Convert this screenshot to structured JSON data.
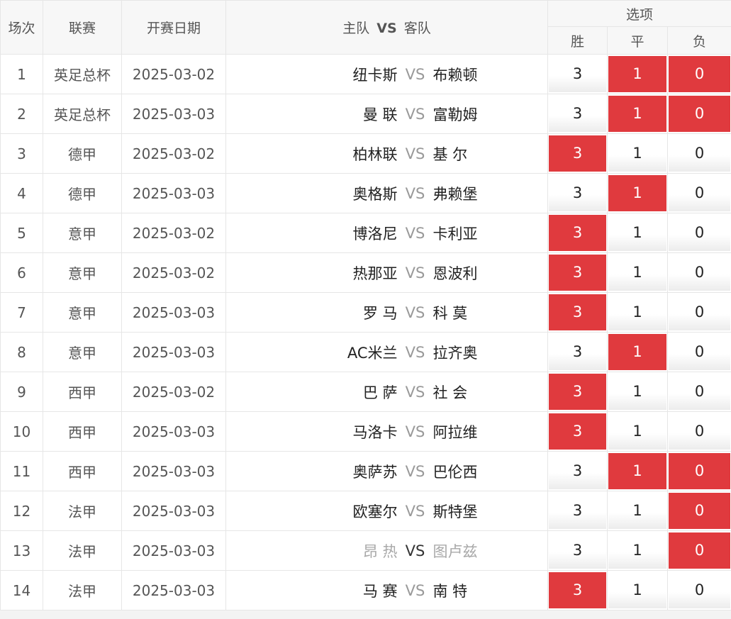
{
  "header": {
    "idx": "场次",
    "league": "联赛",
    "date": "开赛日期",
    "home": "主队",
    "vs": "VS",
    "away": "客队",
    "options": "选项",
    "win": "胜",
    "draw": "平",
    "lose": "负"
  },
  "colors": {
    "selected": "#e03a3e",
    "header_bg": "#f7f7f7"
  },
  "rows": [
    {
      "idx": "1",
      "league": "英足总杯",
      "date": "2025-03-02",
      "home": "纽卡斯",
      "vs": "VS",
      "away": "布赖顿",
      "win": "3",
      "draw": "1",
      "lose": "0",
      "sel": [
        "draw",
        "lose"
      ]
    },
    {
      "idx": "2",
      "league": "英足总杯",
      "date": "2025-03-03",
      "home": "曼 联",
      "vs": "VS",
      "away": "富勒姆",
      "win": "3",
      "draw": "1",
      "lose": "0",
      "sel": [
        "draw",
        "lose"
      ]
    },
    {
      "idx": "3",
      "league": "德甲",
      "date": "2025-03-02",
      "home": "柏林联",
      "vs": "VS",
      "away": "基 尔",
      "win": "3",
      "draw": "1",
      "lose": "0",
      "sel": [
        "win"
      ]
    },
    {
      "idx": "4",
      "league": "德甲",
      "date": "2025-03-03",
      "home": "奥格斯",
      "vs": "VS",
      "away": "弗赖堡",
      "win": "3",
      "draw": "1",
      "lose": "0",
      "sel": [
        "draw"
      ]
    },
    {
      "idx": "5",
      "league": "意甲",
      "date": "2025-03-02",
      "home": "博洛尼",
      "vs": "VS",
      "away": "卡利亚",
      "win": "3",
      "draw": "1",
      "lose": "0",
      "sel": [
        "win"
      ]
    },
    {
      "idx": "6",
      "league": "意甲",
      "date": "2025-03-02",
      "home": "热那亚",
      "vs": "VS",
      "away": "恩波利",
      "win": "3",
      "draw": "1",
      "lose": "0",
      "sel": [
        "win"
      ]
    },
    {
      "idx": "7",
      "league": "意甲",
      "date": "2025-03-03",
      "home": "罗 马",
      "vs": "VS",
      "away": "科 莫",
      "win": "3",
      "draw": "1",
      "lose": "0",
      "sel": [
        "win"
      ]
    },
    {
      "idx": "8",
      "league": "意甲",
      "date": "2025-03-03",
      "home": "AC米兰",
      "vs": "VS",
      "away": "拉齐奥",
      "win": "3",
      "draw": "1",
      "lose": "0",
      "sel": [
        "draw"
      ]
    },
    {
      "idx": "9",
      "league": "西甲",
      "date": "2025-03-02",
      "home": "巴 萨",
      "vs": "VS",
      "away": "社 会",
      "win": "3",
      "draw": "1",
      "lose": "0",
      "sel": [
        "win"
      ]
    },
    {
      "idx": "10",
      "league": "西甲",
      "date": "2025-03-03",
      "home": "马洛卡",
      "vs": "VS",
      "away": "阿拉维",
      "win": "3",
      "draw": "1",
      "lose": "0",
      "sel": [
        "win"
      ]
    },
    {
      "idx": "11",
      "league": "西甲",
      "date": "2025-03-03",
      "home": "奥萨苏",
      "vs": "VS",
      "away": "巴伦西",
      "win": "3",
      "draw": "1",
      "lose": "0",
      "sel": [
        "draw",
        "lose"
      ]
    },
    {
      "idx": "12",
      "league": "法甲",
      "date": "2025-03-03",
      "home": "欧塞尔",
      "vs": "VS",
      "away": "斯特堡",
      "win": "3",
      "draw": "1",
      "lose": "0",
      "sel": [
        "lose"
      ]
    },
    {
      "idx": "13",
      "league": "法甲",
      "date": "2025-03-03",
      "home": "昂 热",
      "vs": "VS",
      "away": "图卢兹",
      "win": "3",
      "draw": "1",
      "lose": "0",
      "sel": [
        "lose"
      ],
      "muted": true
    },
    {
      "idx": "14",
      "league": "法甲",
      "date": "2025-03-03",
      "home": "马 赛",
      "vs": "VS",
      "away": "南 特",
      "win": "3",
      "draw": "1",
      "lose": "0",
      "sel": [
        "win"
      ]
    }
  ]
}
